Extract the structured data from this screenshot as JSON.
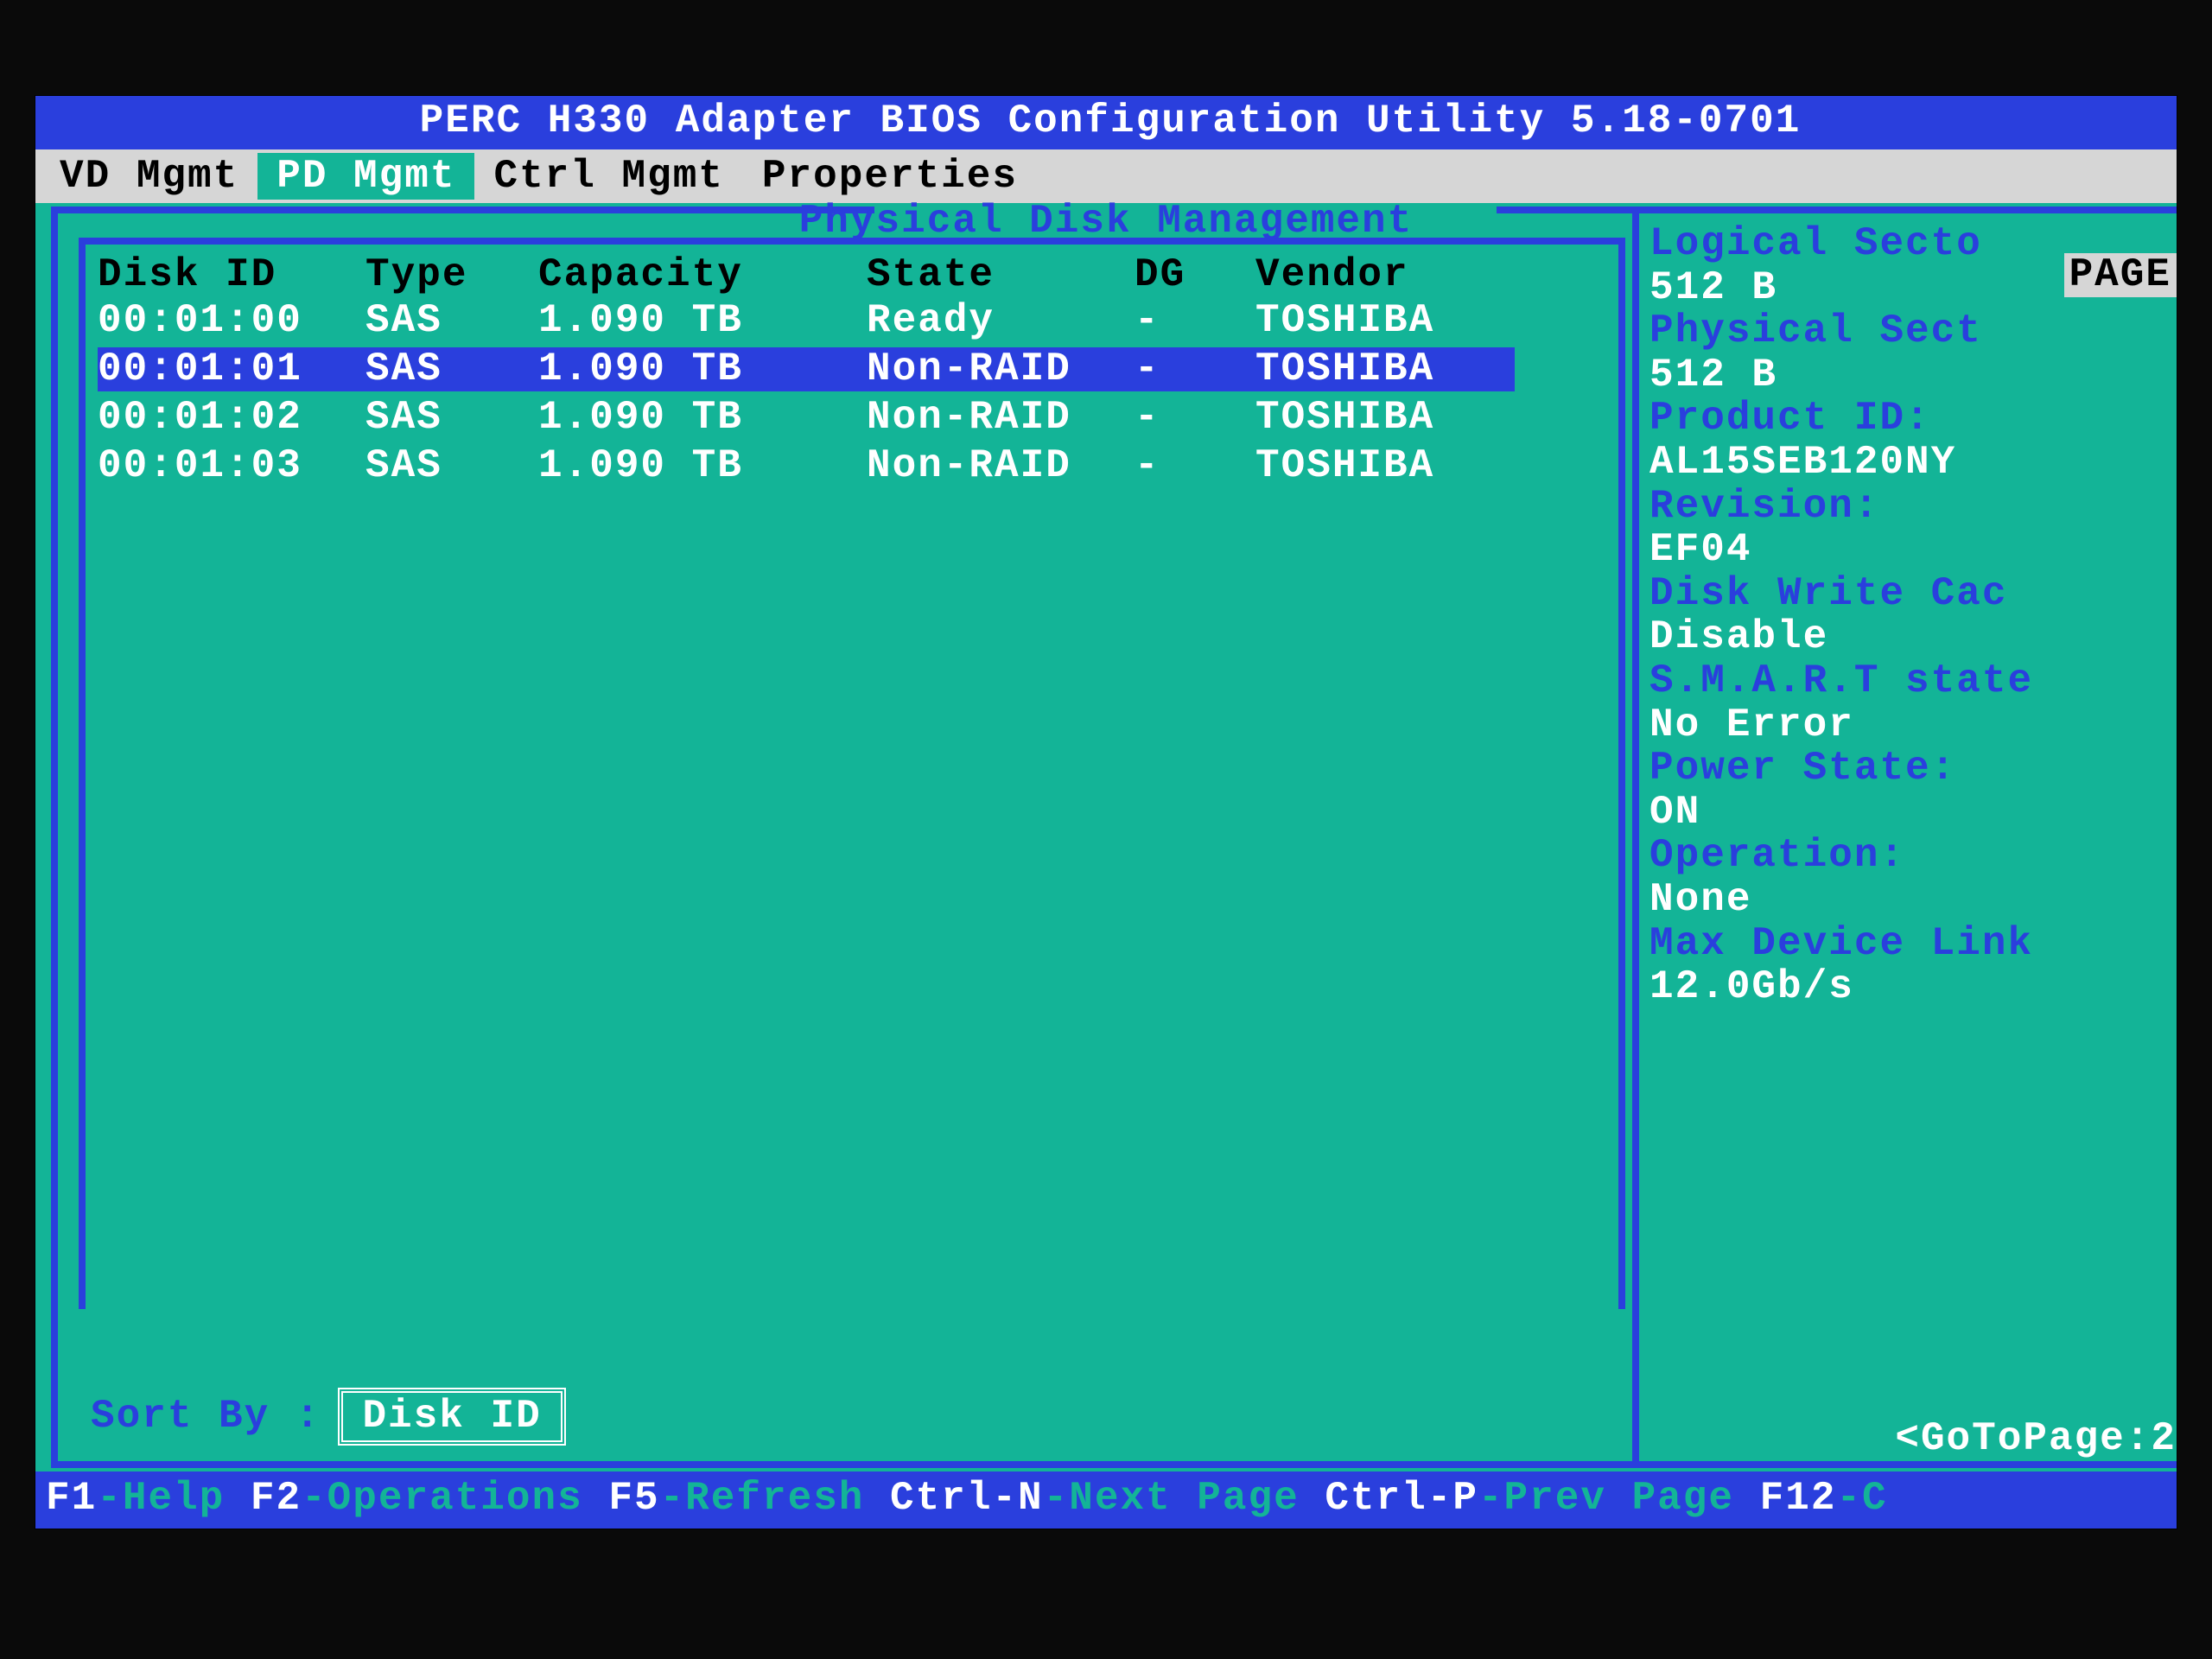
{
  "title": "PERC H330 Adapter BIOS Configuration Utility 5.18-0701",
  "tabs": {
    "vd": "VD Mgmt",
    "pd": "PD Mgmt",
    "ctrl": "Ctrl Mgmt",
    "prop": "Properties"
  },
  "active_tab": "pd",
  "screen_title": "Physical Disk Management",
  "columns": {
    "disk_id": "Disk ID",
    "type": "Type",
    "capacity": "Capacity",
    "state": "State",
    "dg": "DG",
    "vendor": "Vendor"
  },
  "rows": [
    {
      "disk_id": "00:01:00",
      "type": "SAS",
      "capacity": "1.090 TB",
      "state": "Ready",
      "dg": "-",
      "vendor": "TOSHIBA",
      "selected": false
    },
    {
      "disk_id": "00:01:01",
      "type": "SAS",
      "capacity": "1.090 TB",
      "state": "Non-RAID",
      "dg": "-",
      "vendor": "TOSHIBA",
      "selected": true
    },
    {
      "disk_id": "00:01:02",
      "type": "SAS",
      "capacity": "1.090 TB",
      "state": "Non-RAID",
      "dg": "-",
      "vendor": "TOSHIBA",
      "selected": false
    },
    {
      "disk_id": "00:01:03",
      "type": "SAS",
      "capacity": "1.090 TB",
      "state": "Non-RAID",
      "dg": "-",
      "vendor": "TOSHIBA",
      "selected": false
    }
  ],
  "sort": {
    "label": "Sort By :",
    "value": "Disk ID"
  },
  "properties": {
    "page_label": "PAGE",
    "logical_sector_label": "Logical Secto",
    "logical_sector_value": "512 B",
    "physical_sector_label": "Physical Sect",
    "physical_sector_value": "512 B",
    "product_id_label": "Product ID:",
    "product_id_value": "AL15SEB120NY",
    "revision_label": "Revision:",
    "revision_value": "EF04",
    "disk_write_cache_label": "Disk Write Cac",
    "disk_write_cache_value": "Disable",
    "smart_label": "S.M.A.R.T state",
    "smart_value": "No Error",
    "power_state_label": "Power State:",
    "power_state_value": "ON",
    "operation_label": "Operation:",
    "operation_value": "None",
    "max_link_label": "Max Device Link",
    "max_link_value": "12.0Gb/s",
    "goto": "<GoToPage:2"
  },
  "status": {
    "f1_k": "F1",
    "f1_d": "-Help ",
    "f2_k": "F2",
    "f2_d": "-Operations ",
    "f5_k": "F5",
    "f5_d": "-Refresh ",
    "cn_k": "Ctrl-N",
    "cn_d": "-Next Page ",
    "cp_k": "Ctrl-P",
    "cp_d": "-Prev Page ",
    "f12_k": "F12",
    "f12_d": "-C"
  }
}
